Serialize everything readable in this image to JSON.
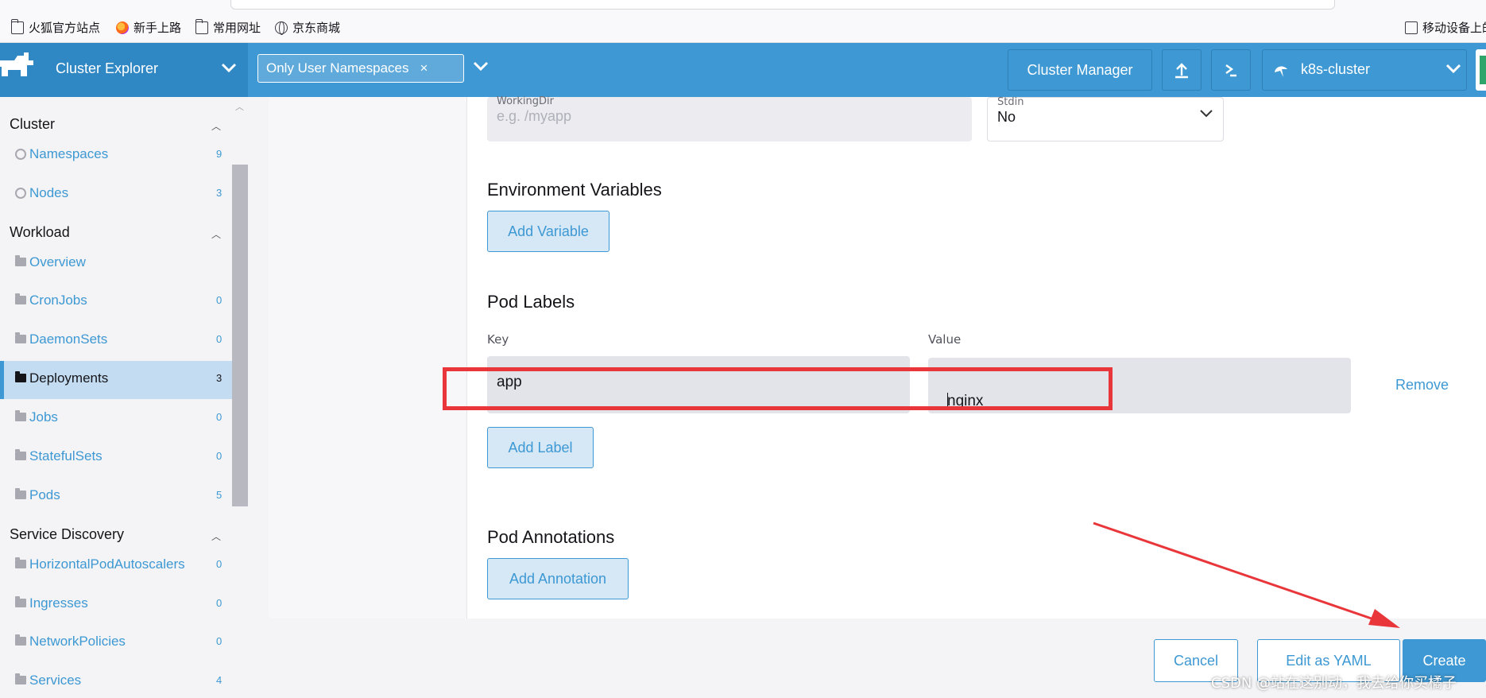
{
  "bookmarks": [
    {
      "label": "火狐官方站点",
      "icon": "folder-icon"
    },
    {
      "label": "新手上路",
      "icon": "firefox-icon"
    },
    {
      "label": "常用网址",
      "icon": "folder-icon"
    },
    {
      "label": "京东商城",
      "icon": "globe-icon"
    }
  ],
  "bookmarks_right": "移动设备上的",
  "header": {
    "app_title": "Cluster Explorer",
    "namespace_chip": "Only User Namespaces",
    "chip_remove": "×",
    "cluster_manager": "Cluster Manager",
    "cluster_name": "k8s-cluster"
  },
  "sidebar": {
    "groups": [
      {
        "label": "Cluster",
        "items": [
          {
            "label": "Namespaces",
            "count": "9"
          },
          {
            "label": "Nodes",
            "count": "3"
          }
        ]
      },
      {
        "label": "Workload",
        "items": [
          {
            "label": "Overview",
            "count": ""
          },
          {
            "label": "CronJobs",
            "count": "0"
          },
          {
            "label": "DaemonSets",
            "count": "0"
          },
          {
            "label": "Deployments",
            "count": "3"
          },
          {
            "label": "Jobs",
            "count": "0"
          },
          {
            "label": "StatefulSets",
            "count": "0"
          },
          {
            "label": "Pods",
            "count": "5"
          }
        ]
      },
      {
        "label": "Service Discovery",
        "items": [
          {
            "label": "HorizontalPodAutoscalers",
            "count": "0"
          },
          {
            "label": "Ingresses",
            "count": "0"
          },
          {
            "label": "NetworkPolicies",
            "count": "0"
          },
          {
            "label": "Services",
            "count": "4"
          }
        ]
      }
    ],
    "active_item": "Deployments"
  },
  "form": {
    "workingdir_label": "WorkingDir",
    "workingdir_placeholder": "e.g. /myapp",
    "stdin_label": "Stdin",
    "stdin_value": "No",
    "env_title": "Environment Variables",
    "add_variable": "Add Variable",
    "pod_labels_title": "Pod Labels",
    "key_header": "Key",
    "value_header": "Value",
    "label_key": "app",
    "label_value": "nginx",
    "remove": "Remove",
    "add_label": "Add Label",
    "pod_annotations_title": "Pod Annotations",
    "add_annotation": "Add Annotation"
  },
  "footer": {
    "cancel": "Cancel",
    "edit_yaml": "Edit as YAML",
    "create": "Create"
  },
  "watermark": "CSDN @站在这别动，我去给你买橘子",
  "colors": {
    "accent": "#3d98d3",
    "annotation_red": "#e8363a",
    "active_bg": "#c3dcf1"
  }
}
